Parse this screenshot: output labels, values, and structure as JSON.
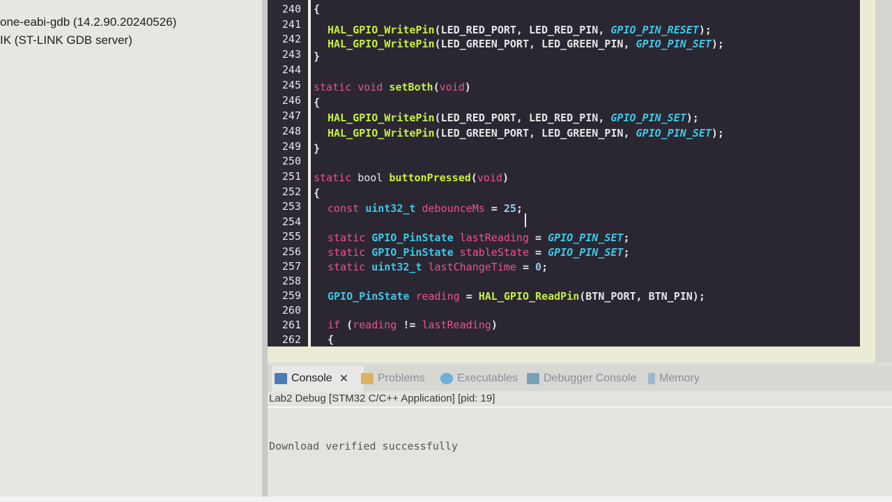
{
  "debugger": {
    "gdb_line": "one-eabi-gdb (14.2.90.20240526)",
    "server_line": "IK (ST-LINK GDB server)"
  },
  "editor": {
    "lines": [
      {
        "n": "240"
      },
      {
        "n": "241"
      },
      {
        "n": "242"
      },
      {
        "n": "243"
      },
      {
        "n": "244"
      },
      {
        "n": "245"
      },
      {
        "n": "246"
      },
      {
        "n": "247"
      },
      {
        "n": "248"
      },
      {
        "n": "249"
      },
      {
        "n": "250"
      },
      {
        "n": "251"
      },
      {
        "n": "252"
      },
      {
        "n": "253"
      },
      {
        "n": "254"
      },
      {
        "n": "255"
      },
      {
        "n": "256"
      },
      {
        "n": "257"
      },
      {
        "n": "258"
      },
      {
        "n": "259"
      },
      {
        "n": "260"
      },
      {
        "n": "261"
      },
      {
        "n": "262"
      }
    ],
    "code": {
      "l240": "{",
      "l241_fn": "HAL_GPIO_WritePin",
      "l241_args": "(LED_RED_PORT, LED_RED_PIN, ",
      "l241_const": "GPIO_PIN_RESET",
      "l242_fn": "HAL_GPIO_WritePin",
      "l242_args": "(LED_GREEN_PORT, LED_GREEN_PIN, ",
      "l242_const": "GPIO_PIN_SET",
      "l243": "}",
      "l245_kw1": "static",
      "l245_kw2": "void",
      "l245_fn": "setBoth",
      "l245_param": "void",
      "l246": "{",
      "l247_fn": "HAL_GPIO_WritePin",
      "l247_args": "(LED_RED_PORT, LED_RED_PIN, ",
      "l247_const": "GPIO_PIN_SET",
      "l248_fn": "HAL_GPIO_WritePin",
      "l248_args": "(LED_GREEN_PORT, LED_GREEN_PIN, ",
      "l248_const": "GPIO_PIN_SET",
      "l249": "}",
      "l251_kw1": "static",
      "l251_ty": "bool",
      "l251_fn": "buttonPressed",
      "l251_param": "void",
      "l252": "{",
      "l253_kw": "const",
      "l253_ty": "uint32_t",
      "l253_var": "debounceMs",
      "l253_val": "25",
      "l255_kw": "static",
      "l255_ty": "GPIO_PinState",
      "l255_var": "lastReading",
      "l255_const": "GPIO_PIN_SET",
      "l256_kw": "static",
      "l256_ty": "GPIO_PinState",
      "l256_var": "stableState",
      "l256_const": "GPIO_PIN_SET",
      "l257_kw": "static",
      "l257_ty": "uint32_t",
      "l257_var": "lastChangeTime",
      "l257_val": "0",
      "l259_ty": "GPIO_PinState",
      "l259_var": "reading",
      "l259_fn": "HAL_GPIO_ReadPin",
      "l259_args": "(BTN_PORT, BTN_PIN);",
      "l261_kw": "if",
      "l261_var1": "reading",
      "l261_var2": "lastReading",
      "l262": "{"
    }
  },
  "console": {
    "tabs": [
      {
        "label": "Console",
        "icon": "console-icon"
      },
      {
        "label": "Problems",
        "icon": "problems-icon"
      },
      {
        "label": "Executables",
        "icon": "executables-icon"
      },
      {
        "label": "Debugger Console",
        "icon": "debugger-console-icon"
      },
      {
        "label": "Memory",
        "icon": "memory-icon"
      }
    ],
    "close_glyph": "✕",
    "header": "Lab2 Debug [STM32 C/C++ Application]  [pid: 19]",
    "output": "Download verified successfully"
  },
  "colors": {
    "editor_bg": "#2a2733",
    "keyword": "#f0508c",
    "function": "#c8f03c",
    "type": "#3ec8e6"
  }
}
